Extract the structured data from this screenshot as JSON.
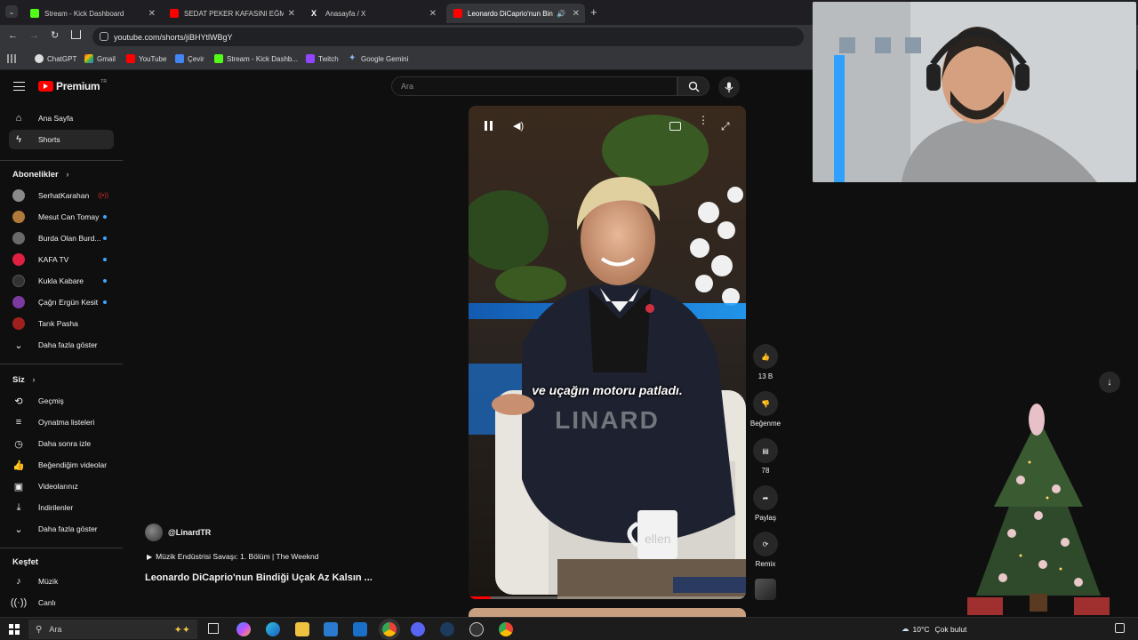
{
  "browser": {
    "tabs": [
      {
        "title": "Stream - Kick Dashboard",
        "color": "#53fc18"
      },
      {
        "title": "SEDAT PEKER KAFASINI EĞMEY",
        "color": "#ff0000"
      },
      {
        "title": "Anasayfa / X",
        "color": "#ffffff"
      },
      {
        "title": "Leonardo DiCaprio'nun Bin",
        "color": "#ff0000"
      }
    ],
    "url": "youtube.com/shorts/jiBHYtlWBgY",
    "bookmarks": [
      "ChatGPT",
      "Gmail",
      "YouTube",
      "Çevir",
      "Stream - Kick Dashb...",
      "Twitch",
      "Google Gemini"
    ]
  },
  "youtube": {
    "logo_text": "Premium",
    "logo_sup": "TR",
    "search_placeholder": "Ara",
    "nav": [
      {
        "label": "Ana Sayfa",
        "icon": "home-icon"
      },
      {
        "label": "Shorts",
        "icon": "shorts-icon"
      }
    ],
    "subscriptions_title": "Abonelikler",
    "subscriptions": [
      {
        "label": "SerhatKarahan",
        "live": true,
        "color": "#8a8a8a"
      },
      {
        "label": "Mesut Can Tomay",
        "live": false,
        "color": "#b07a3a"
      },
      {
        "label": "Burda Olan Burd...",
        "live": false,
        "color": "#6a6a6a"
      },
      {
        "label": "KAFA TV",
        "live": false,
        "color": "#e02040"
      },
      {
        "label": "Kukla Kabare",
        "live": false,
        "color": "#333333"
      },
      {
        "label": "Çağrı Ergün Kesit",
        "live": false,
        "color": "#7a3aa0"
      },
      {
        "label": "Tarık Pasha",
        "live": false,
        "color": "#a02020"
      }
    ],
    "show_more": "Daha fazla göster",
    "you_title": "Siz",
    "you_items": [
      {
        "label": "Geçmiş",
        "icon": "history-icon"
      },
      {
        "label": "Oynatma listeleri",
        "icon": "playlist-icon"
      },
      {
        "label": "Daha sonra izle",
        "icon": "clock-icon"
      },
      {
        "label": "Beğendiğim videolar",
        "icon": "like-icon"
      },
      {
        "label": "Videolarınız",
        "icon": "video-icon"
      },
      {
        "label": "İndirilenler",
        "icon": "download-icon"
      }
    ],
    "show_more_2": "Daha fazla göster",
    "explore_title": "Keşfet",
    "explore_items": [
      {
        "label": "Müzik",
        "icon": "music-icon"
      },
      {
        "label": "Canlı",
        "icon": "live-icon"
      }
    ],
    "short": {
      "channel": "@LinardTR",
      "music": "Müzik Endüstrisi Savaşı: 1. Bölüm | The Weeknd",
      "title": "Leonardo DiCaprio'nun Bindiği Uçak Az Kalsın ...",
      "caption": "ve uçağın motoru patladı.",
      "watermark": "LINARD",
      "mug_text": "ellen",
      "progress": 0.08
    },
    "actions": {
      "likes": "13 B",
      "dislike": "Beğenme",
      "comments": "78",
      "share": "Paylaş",
      "remix": "Remix"
    }
  },
  "taskbar": {
    "search": "Ara",
    "weather": "10°C",
    "weather_text": "Çok bulut"
  }
}
